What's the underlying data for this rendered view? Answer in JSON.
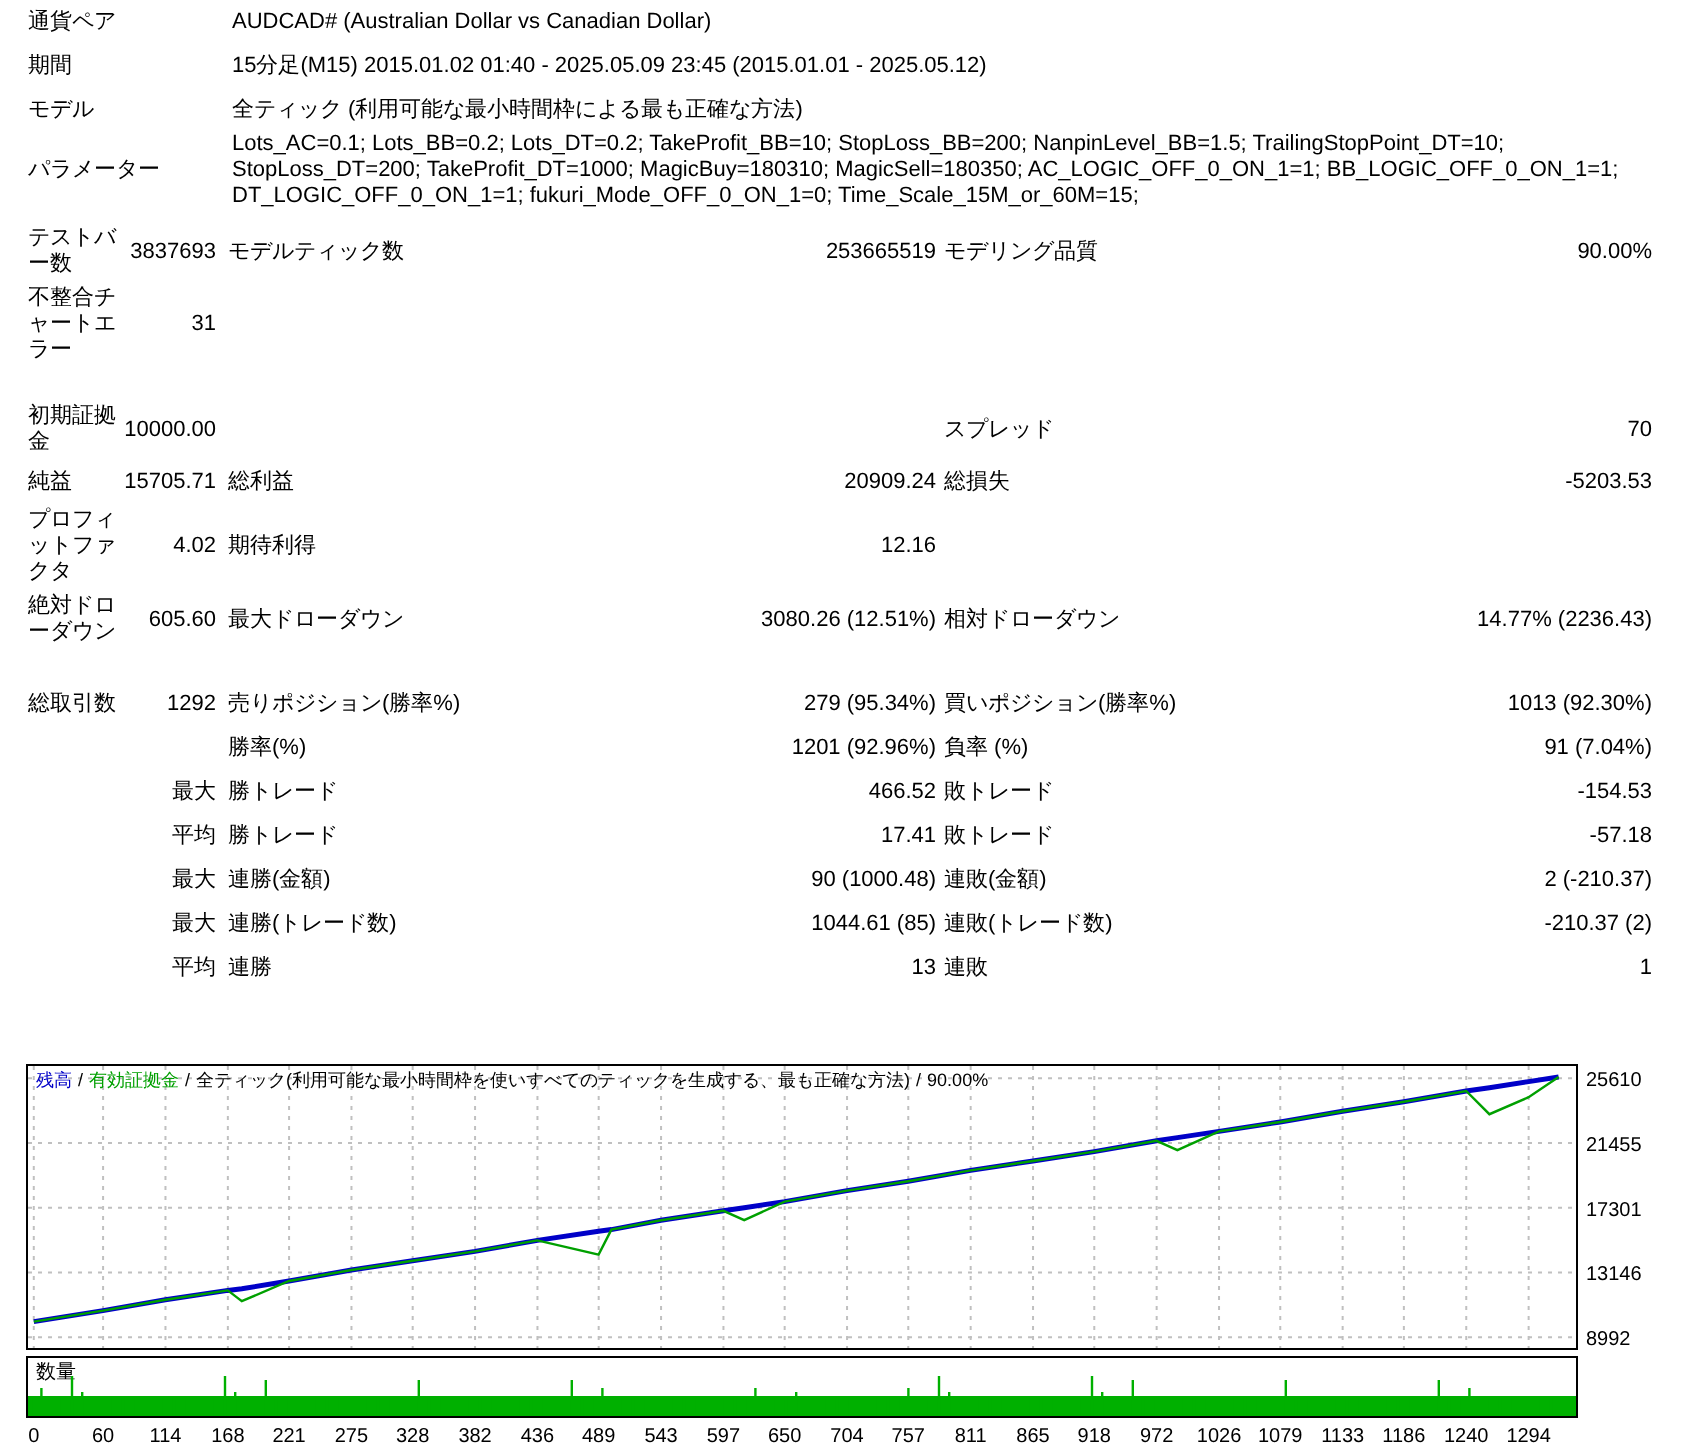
{
  "info": [
    {
      "label": "通貨ペア",
      "value": "AUDCAD# (Australian Dollar vs Canadian Dollar)"
    },
    {
      "label": "期間",
      "value": "15分足(M15) 2015.01.02 01:40 - 2025.05.09 23:45 (2015.01.01 - 2025.05.12)"
    },
    {
      "label": "モデル",
      "value": "全ティック (利用可能な最小時間枠による最も正確な方法)"
    },
    {
      "label": "パラメーター",
      "value": "Lots_AC=0.1; Lots_BB=0.2; Lots_DT=0.2; TakeProfit_BB=10; StopLoss_BB=200; NanpinLevel_BB=1.5; TrailingStopPoint_DT=10; StopLoss_DT=200; TakeProfit_DT=1000; MagicBuy=180310; MagicSell=180350; AC_LOGIC_OFF_0_ON_1=1; BB_LOGIC_OFF_0_ON_1=1; DT_LOGIC_OFF_0_ON_1=1; fukuri_Mode_OFF_0_ON_1=0; Time_Scale_15M_or_60M=15;"
    }
  ],
  "stat_groups": [
    [
      {
        "label": "テストバー数",
        "value": "3837693",
        "label_2": "モデルティック数",
        "value_2": "253665519",
        "label_3": "モデリング品質",
        "value_3": "90.00%"
      },
      {
        "label": "不整合チャートエラー",
        "value": "31"
      }
    ],
    [
      {
        "label": "初期証拠金",
        "value": "10000.00",
        "label_3": "スプレッド",
        "value_3": "70"
      },
      {
        "label": "純益",
        "value": "15705.71",
        "label_2": "総利益",
        "value_2": "20909.24",
        "label_3": "総損失",
        "value_3": "-5203.53"
      },
      {
        "label": "プロフィットファクタ",
        "value": "4.02",
        "label_2": "期待利得",
        "value_2": "12.16"
      },
      {
        "label": "絶対ドローダウン",
        "value": "605.60",
        "label_2": "最大ドローダウン",
        "value_2": "3080.26 (12.51%)",
        "label_3": "相対ドローダウン",
        "value_3": "14.77% (2236.43)"
      }
    ],
    [
      {
        "label": "総取引数",
        "value": "1292",
        "label_2": "売りポジション(勝率%)",
        "value_2": "279 (95.34%)",
        "label_3": "買いポジション(勝率%)",
        "value_3": "1013 (92.30%)"
      },
      {
        "label_2": "勝率(%)",
        "value_2": "1201 (92.96%)",
        "label_3": "負率 (%)",
        "value_3": "91 (7.04%)"
      },
      {
        "value": "最大",
        "label_2": "勝トレード",
        "value_2": "466.52",
        "label_3": "敗トレード",
        "value_3": "-154.53"
      },
      {
        "value": "平均",
        "label_2": "勝トレード",
        "value_2": "17.41",
        "label_3": "敗トレード",
        "value_3": "-57.18"
      },
      {
        "value": "最大",
        "label_2": "連勝(金額)",
        "value_2": "90 (1000.48)",
        "label_3": "連敗(金額)",
        "value_3": "2 (-210.37)"
      },
      {
        "value": "最大",
        "label_2": "連勝(トレード数)",
        "value_2": "1044.61 (85)",
        "label_3": "連敗(トレード数)",
        "value_3": "-210.37 (2)"
      },
      {
        "value": "平均",
        "label_2": "連勝",
        "value_2": "13",
        "label_3": "連敗",
        "value_3": "1"
      }
    ]
  ],
  "chart": {
    "legend_separators": [
      "/",
      "/",
      "/"
    ],
    "legend_model": "全ティック(利用可能な最小時間枠を使いすべてのティックを生成する、最も正確な方法)",
    "legend_quality": "90.00%",
    "volume_label": "数量",
    "chart_data": {
      "type": "line",
      "x": [
        0,
        60,
        114,
        168,
        180,
        221,
        275,
        328,
        382,
        436,
        489,
        500,
        543,
        597,
        615,
        650,
        704,
        757,
        811,
        865,
        918,
        972,
        990,
        1026,
        1079,
        1133,
        1186,
        1240,
        1260,
        1294,
        1320
      ],
      "series": [
        {
          "name": "残高",
          "color": "#0000c8",
          "values": [
            10000,
            10700,
            11400,
            12000,
            12100,
            12600,
            13300,
            13900,
            14500,
            15200,
            15800,
            15900,
            16500,
            17100,
            17300,
            17700,
            18400,
            19000,
            19700,
            20300,
            20900,
            21600,
            21800,
            22200,
            22800,
            23500,
            24100,
            24800,
            25000,
            25400,
            25700
          ]
        },
        {
          "name": "有効証拠金",
          "color": "#00a000",
          "values": [
            10000,
            10700,
            11400,
            12000,
            11300,
            12600,
            13300,
            13900,
            14500,
            15200,
            14300,
            15900,
            16500,
            17100,
            16500,
            17700,
            18400,
            19000,
            19700,
            20300,
            20900,
            21600,
            21000,
            22200,
            22800,
            23500,
            24100,
            24800,
            23300,
            24400,
            25700
          ]
        }
      ],
      "grid": true,
      "xticks": [
        0,
        60,
        114,
        168,
        221,
        275,
        328,
        382,
        436,
        489,
        543,
        597,
        650,
        704,
        757,
        811,
        865,
        918,
        972,
        1026,
        1079,
        1133,
        1186,
        1240,
        1294
      ],
      "yticks": [
        8992,
        13146,
        17301,
        21455,
        25610
      ],
      "xlim": [
        -5,
        1335
      ],
      "ylim": [
        8300,
        26400
      ]
    }
  }
}
